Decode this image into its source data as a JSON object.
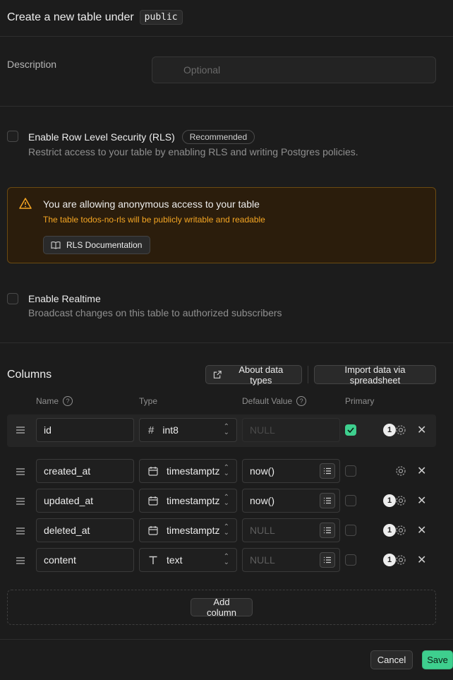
{
  "header": {
    "title": "Create a new table under",
    "schema": "public"
  },
  "description": {
    "label": "Description",
    "placeholder": "Optional",
    "value": ""
  },
  "rls": {
    "label": "Enable Row Level Security (RLS)",
    "badge": "Recommended",
    "subtitle": "Restrict access to your table by enabling RLS and writing Postgres policies.",
    "checked": false
  },
  "warning": {
    "title": "You are allowing anonymous access to your table",
    "subtitle": "The table todos-no-rls will be publicly writable and readable",
    "button": "RLS Documentation"
  },
  "realtime": {
    "label": "Enable Realtime",
    "subtitle": "Broadcast changes on this table to authorized subscribers",
    "checked": false
  },
  "columns": {
    "title": "Columns",
    "about_button": "About data types",
    "import_button": "Import data via spreadsheet",
    "headers": {
      "name": "Name",
      "type": "Type",
      "default": "Default Value",
      "primary": "Primary"
    },
    "rows": [
      {
        "name": "id",
        "type": "int8",
        "type_icon": "hash-icon",
        "default": "NULL",
        "primary": true,
        "count": "1"
      },
      {
        "name": "created_at",
        "type": "timestamptz",
        "type_icon": "calendar-icon",
        "default": "now()",
        "primary": false,
        "count": ""
      },
      {
        "name": "updated_at",
        "type": "timestamptz",
        "type_icon": "calendar-icon",
        "default": "now()",
        "primary": false,
        "count": "1"
      },
      {
        "name": "deleted_at",
        "type": "timestamptz",
        "type_icon": "calendar-icon",
        "default": "NULL",
        "primary": false,
        "count": "1"
      },
      {
        "name": "content",
        "type": "text",
        "type_icon": "text-type-icon",
        "default": "NULL",
        "primary": false,
        "count": "1"
      }
    ],
    "add_button": "Add column"
  },
  "footer": {
    "cancel": "Cancel",
    "save": "Save"
  },
  "colors": {
    "accent": "#3ecf8e",
    "warning": "#f5a623",
    "background": "#1c1c1c"
  }
}
